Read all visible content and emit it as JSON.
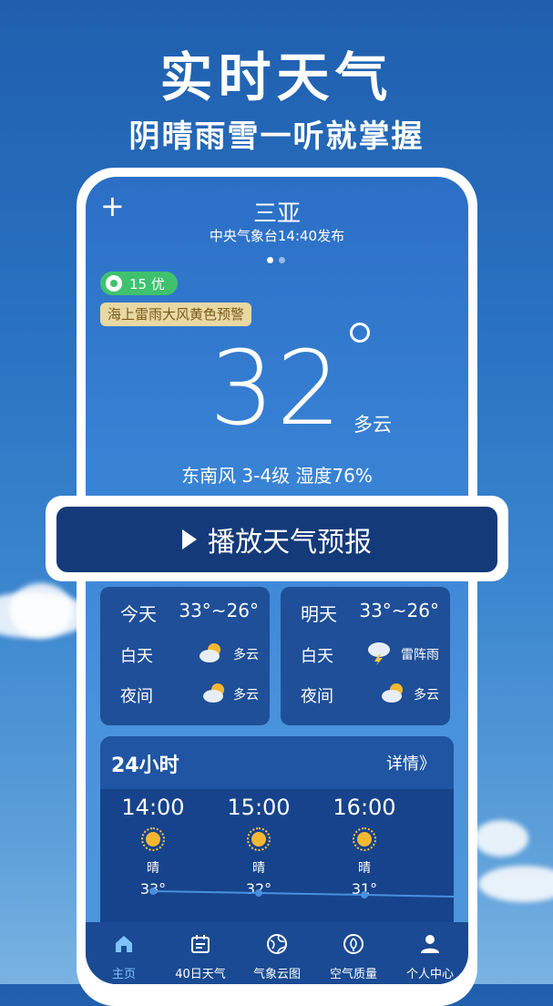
{
  "promo": {
    "title": "实时天气",
    "subtitle": "阴晴雨雪一听就掌握"
  },
  "header": {
    "add_icon": "plus-icon",
    "city": "三亚",
    "publish": "中央气象台14:40发布",
    "page_dots": {
      "count": 2,
      "active": 0
    }
  },
  "aqi": {
    "value": "15 优",
    "color": "#3ec26e"
  },
  "warning": "海上雷雨大风黄色预警",
  "current": {
    "temp": "32",
    "condition": "多云",
    "wind_humidity": "东南风 3-4级  湿度76%"
  },
  "play_button": "播放天气预报",
  "days": [
    {
      "name": "今天",
      "range": "33°~26°",
      "day_label": "白天",
      "day_icon": "partly-cloudy-icon",
      "day_cond": "多云",
      "night_label": "夜间",
      "night_icon": "partly-cloudy-icon",
      "night_cond": "多云"
    },
    {
      "name": "明天",
      "range": "33°~26°",
      "day_label": "白天",
      "day_icon": "thunderstorm-icon",
      "day_cond": "雷阵雨",
      "night_label": "夜间",
      "night_icon": "partly-cloudy-icon",
      "night_cond": "多云"
    }
  ],
  "hourly": {
    "title": "24小时",
    "more": "详情》",
    "items": [
      {
        "time": "14:00",
        "icon": "sun-icon",
        "weather": "晴",
        "temp": "33°"
      },
      {
        "time": "15:00",
        "icon": "sun-icon",
        "weather": "晴",
        "temp": "32°"
      },
      {
        "time": "16:00",
        "icon": "sun-icon",
        "weather": "晴",
        "temp": "31°"
      }
    ]
  },
  "tabs": [
    {
      "label": "主页",
      "icon": "home-icon",
      "active": true
    },
    {
      "label": "40日天气",
      "icon": "calendar-icon",
      "active": false
    },
    {
      "label": "气象云图",
      "icon": "globe-icon",
      "active": false
    },
    {
      "label": "空气质量",
      "icon": "leaf-icon",
      "active": false
    },
    {
      "label": "个人中心",
      "icon": "person-icon",
      "active": false
    }
  ],
  "colors": {
    "accent": "#153a7a",
    "active_tab": "#7ec3ff",
    "warning_bg": "#e8d8a4"
  }
}
